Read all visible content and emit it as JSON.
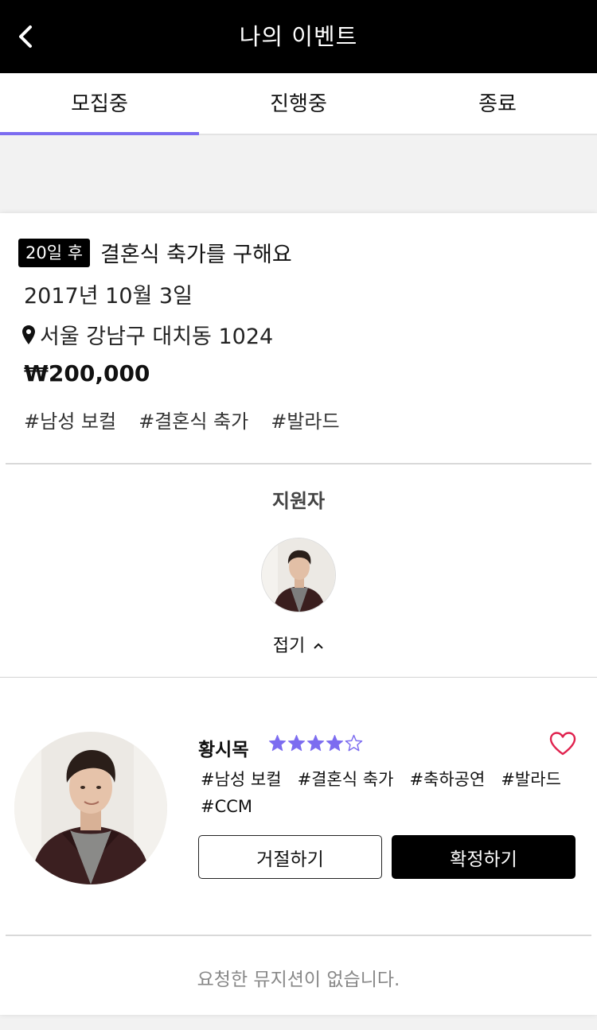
{
  "header": {
    "title": "나의 이벤트",
    "back_icon": "chevron-left-icon"
  },
  "tabs": [
    {
      "label": "모집중",
      "active": true
    },
    {
      "label": "진행중",
      "active": false
    },
    {
      "label": "종료",
      "active": false
    }
  ],
  "event": {
    "dday": "20일 후",
    "title": "결혼식 축가를 구해요",
    "date": "2017년 10월 3일",
    "location": "서울 강남구 대치동 1024",
    "price": "₩200,000",
    "tags": [
      "#남성 보컬",
      "#결혼식 축가",
      "#발라드"
    ]
  },
  "applicants": {
    "title": "지원자",
    "fold_label": "접기"
  },
  "applicant": {
    "name": "황시목",
    "rating": 4,
    "rating_max": 5,
    "tags": [
      "#남성 보컬",
      "#결혼식 축가",
      "#축하공연",
      "#발라드",
      "#CCM"
    ],
    "reject_label": "거절하기",
    "confirm_label": "확정하기"
  },
  "requested": {
    "empty_message": "요청한 뮤지션이 없습니다."
  },
  "colors": {
    "accent": "#7c6cf0",
    "heart": "#e0224e",
    "header_bg": "#000000"
  }
}
